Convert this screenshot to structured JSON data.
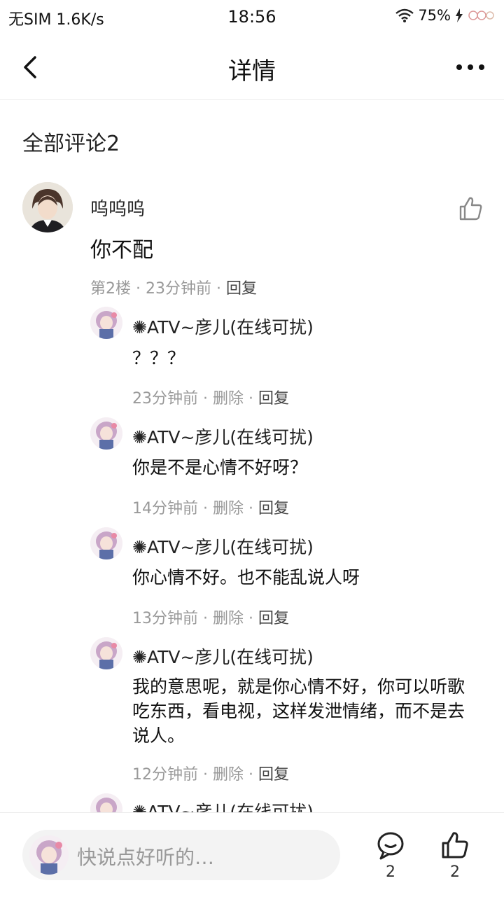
{
  "status_bar": {
    "carrier": "无SIM 1.6K/s",
    "time": "18:56",
    "battery": "75%"
  },
  "nav": {
    "title": "详情"
  },
  "comments_header": "全部评论2",
  "comment": {
    "user": "呜呜呜",
    "text": "你不配",
    "floor": "第2楼",
    "time": "23分钟前",
    "reply_label": "回复",
    "sep": "·"
  },
  "replies": [
    {
      "user": "✺ATV~彦儿(在线可扰)",
      "text": "？？？",
      "time": "23分钟前",
      "delete_label": "删除",
      "reply_label": "回复"
    },
    {
      "user": "✺ATV~彦儿(在线可扰)",
      "text": "你是不是心情不好呀？",
      "time": "14分钟前",
      "delete_label": "删除",
      "reply_label": "回复"
    },
    {
      "user": "✺ATV~彦儿(在线可扰)",
      "text": "你心情不好。也不能乱说人呀",
      "time": "13分钟前",
      "delete_label": "删除",
      "reply_label": "回复"
    },
    {
      "user": "✺ATV~彦儿(在线可扰)",
      "text": "我的意思呢，就是你心情不好，你可以听歌吃东西，看电视，这样发泄情绪，而不是去说人。",
      "time": "12分钟前",
      "delete_label": "删除",
      "reply_label": "回复"
    },
    {
      "user": "✺ATV~彦儿(在线可扰)"
    }
  ],
  "bottom": {
    "placeholder": "快说点好听的…",
    "comment_count": "2",
    "like_count": "2"
  },
  "icons": {
    "back": "chevron-left-icon",
    "more": "more-dots-icon",
    "like": "thumbs-up-icon",
    "comment": "comment-bubble-icon",
    "wifi": "wifi-icon",
    "charging": "lightning-icon"
  }
}
